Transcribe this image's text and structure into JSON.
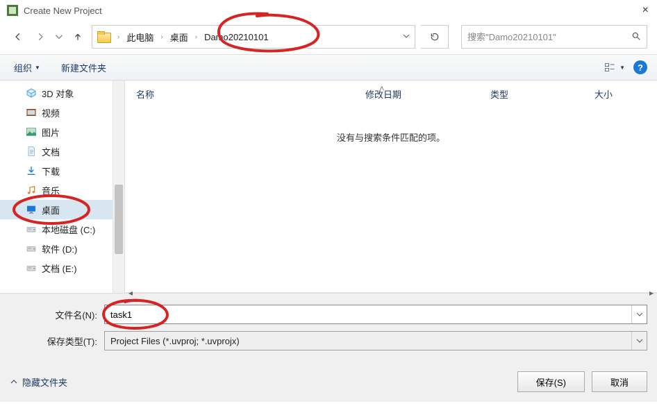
{
  "window": {
    "title": "Create New Project"
  },
  "nav": {
    "breadcrumb": [
      "此电脑",
      "桌面",
      "Damo20210101"
    ],
    "search_placeholder": "搜索\"Damo20210101\""
  },
  "toolbar": {
    "organize": "组织",
    "new_folder": "新建文件夹"
  },
  "columns": {
    "name": "名称",
    "modified": "修改日期",
    "type": "类型",
    "size": "大小"
  },
  "empty_message": "没有与搜索条件匹配的项。",
  "tree": {
    "items": [
      {
        "label": "3D 对象",
        "icon": "cube"
      },
      {
        "label": "视频",
        "icon": "video"
      },
      {
        "label": "图片",
        "icon": "picture"
      },
      {
        "label": "文档",
        "icon": "document"
      },
      {
        "label": "下载",
        "icon": "download"
      },
      {
        "label": "音乐",
        "icon": "music"
      },
      {
        "label": "桌面",
        "icon": "monitor",
        "selected": true
      },
      {
        "label": "本地磁盘 (C:)",
        "icon": "disk"
      },
      {
        "label": "软件 (D:)",
        "icon": "disk"
      },
      {
        "label": "文档 (E:)",
        "icon": "disk"
      }
    ]
  },
  "form": {
    "filename_label": "文件名(N):",
    "filename_value": "task1",
    "filetype_label": "保存类型(T):",
    "filetype_value": "Project Files (*.uvproj; *.uvprojx)"
  },
  "footer": {
    "hide_folders": "隐藏文件夹",
    "save": "保存(S)",
    "cancel": "取消"
  }
}
